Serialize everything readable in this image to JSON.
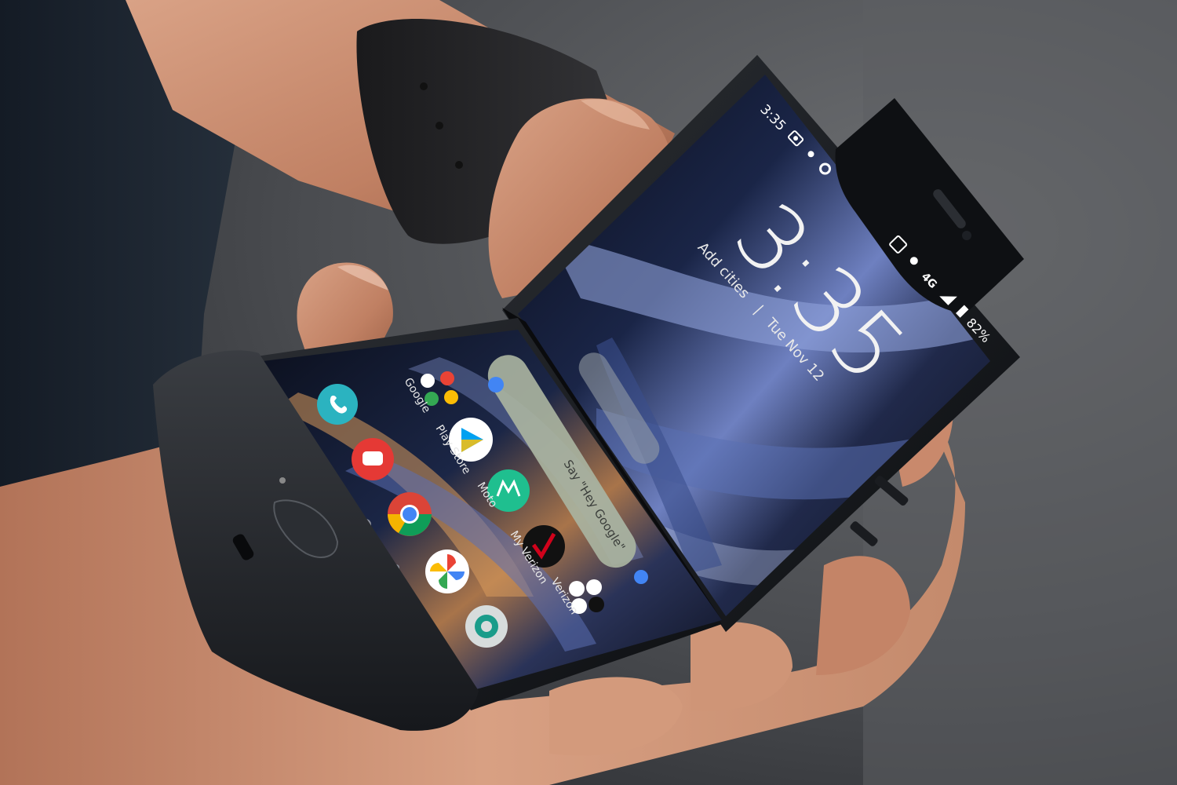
{
  "scene": {
    "subject": "foldable-flip-phone-half-open-in-hand",
    "colors": {
      "background": "#5b5d60",
      "shirt": "#1c2430",
      "skin": "#c98f72",
      "phone_body": "#121417",
      "screen_base": "#0b0f1c",
      "wallpaper_accent": "#7a8fc8",
      "wallpaper_warm": "#b87a4c"
    }
  },
  "upper_screen": {
    "status_time": "3:35",
    "battery_percent": "82%",
    "network": "4G",
    "clock_hour": "3",
    "clock_colon": ":",
    "clock_minutes": "35",
    "date_text": "Tue Nov 12",
    "city_text": "Add cities",
    "separator": "|",
    "status_icons": [
      "camera-icon",
      "brightness-icon",
      "gear-icon",
      "nfc-icon",
      "location-icon",
      "signal-icon",
      "battery-icon"
    ]
  },
  "lower_screen": {
    "search_hint": "Say \"Hey Google\"",
    "apps": [
      {
        "name": "phone",
        "label": "",
        "icon": "phone-icon",
        "color": "#2bb3c0"
      },
      {
        "name": "google",
        "label": "Google",
        "icon": "google-folder-icon",
        "color": "#ffffff"
      },
      {
        "name": "messages",
        "label": "",
        "icon": "chat-icon",
        "color": "#e53935"
      },
      {
        "name": "play-store",
        "label": "Play Store",
        "icon": "play-store-icon",
        "color": "#ffffff"
      },
      {
        "name": "chrome",
        "label": "",
        "icon": "chrome-icon",
        "color": "#4285f4"
      },
      {
        "name": "moto",
        "label": "Moto",
        "icon": "moto-icon",
        "color": "#1fbf8f"
      },
      {
        "name": "photos",
        "label": "",
        "icon": "pinwheel-icon",
        "color": "#ffffff"
      },
      {
        "name": "my-verizon",
        "label": "My Verizon",
        "icon": "check-icon",
        "color": "#d0021b"
      },
      {
        "name": "duo",
        "label": "",
        "icon": "video-icon",
        "color": "#1a9c8a"
      },
      {
        "name": "verizon",
        "label": "Verizon",
        "icon": "verizon-folder-icon",
        "color": "#ffffff"
      }
    ]
  }
}
